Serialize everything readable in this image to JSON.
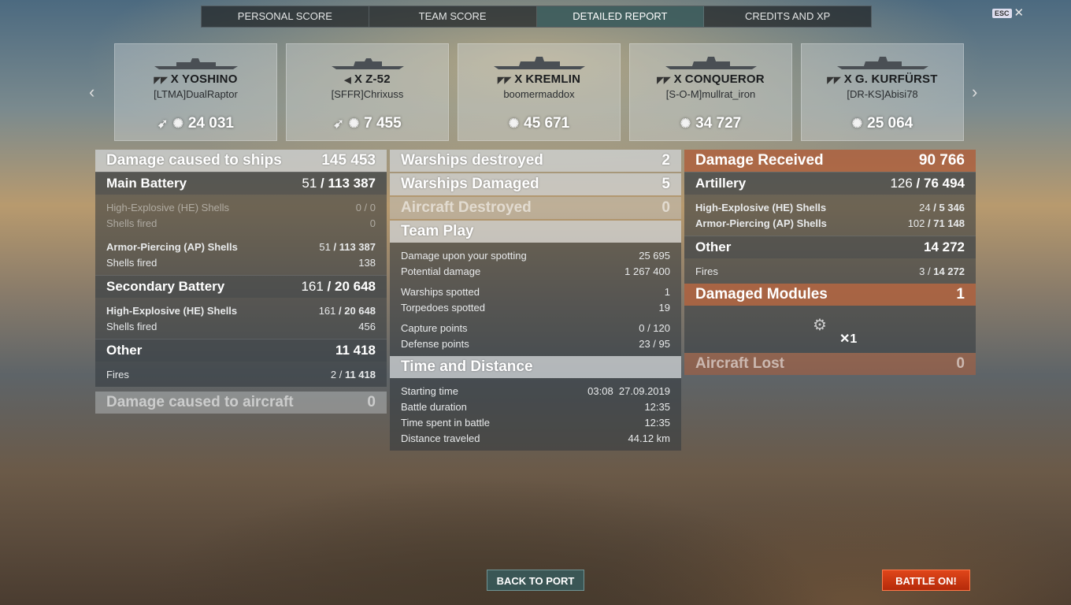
{
  "tabs": [
    "PERSONAL SCORE",
    "TEAM SCORE",
    "DETAILED REPORT",
    "CREDITS AND XP"
  ],
  "active_tab": "DETAILED REPORT",
  "esc": {
    "key": "ESC",
    "close": "✕"
  },
  "cards": [
    {
      "tier": "X",
      "name": "YOSHINO",
      "player": "[LTMA]DualRaptor",
      "score": "24 031",
      "icon": "torpedo-icon"
    },
    {
      "tier": "X",
      "name": "Z-52",
      "player": "[SFFR]Chrixuss",
      "score": "7 455",
      "icon": "torpedo-icon"
    },
    {
      "tier": "X",
      "name": "KREMLIN",
      "player": "boomermaddox",
      "score": "45 671"
    },
    {
      "tier": "X",
      "name": "CONQUEROR",
      "player": "[S-O-M]mullrat_iron",
      "score": "34 727"
    },
    {
      "tier": "X",
      "name": "G. KURFÜRST",
      "player": "[DR-KS]Abisi78",
      "score": "25 064"
    }
  ],
  "dmg": {
    "title": "Damage caused to ships",
    "total": "145 453",
    "main": {
      "title": "Main Battery",
      "a": "51",
      "b": "113 387"
    },
    "he_label": "High-Explosive (HE) Shells",
    "he_val": "0 / 0",
    "fired_label": "Shells fired",
    "he_fired": "0",
    "ap_label": "Armor-Piercing (AP) Shells",
    "ap_a": "51",
    "ap_b": "113 387",
    "ap_fired": "138",
    "sec": {
      "title": "Secondary Battery",
      "a": "161",
      "b": "20 648"
    },
    "sec_he_a": "161",
    "sec_he_b": "20 648",
    "sec_fired": "456",
    "other": {
      "title": "Other",
      "val": "11 418"
    },
    "fires_label": "Fires",
    "fires_a": "2",
    "fires_b": "11 418",
    "aircraft": {
      "title": "Damage caused to aircraft",
      "val": "0"
    }
  },
  "mid": {
    "destroyed": {
      "label": "Warships destroyed",
      "val": "2"
    },
    "damaged": {
      "label": "Warships Damaged",
      "val": "5"
    },
    "aircraft": {
      "label": "Aircraft Destroyed",
      "val": "0"
    },
    "team": {
      "title": "Team Play",
      "spot_dmg": [
        "Damage upon your spotting",
        "25 695"
      ],
      "potential": [
        "Potential damage",
        "1 267 400"
      ],
      "spotted": [
        "Warships spotted",
        "1"
      ],
      "torps": [
        "Torpedoes spotted",
        "19"
      ],
      "capture": [
        "Capture points",
        "0 / 120"
      ],
      "defense": [
        "Defense points",
        "23 / 95"
      ]
    },
    "time": {
      "title": "Time and Distance",
      "start": [
        "Starting time",
        "03:08  27.09.2019"
      ],
      "duration": [
        "Battle duration",
        "12:35"
      ],
      "spent": [
        "Time spent in battle",
        "12:35"
      ],
      "distance": [
        "Distance traveled",
        "44.12 km"
      ]
    }
  },
  "recv": {
    "title": "Damage Received",
    "total": "90 766",
    "art": {
      "title": "Artillery",
      "a": "126",
      "b": "76 494"
    },
    "he": {
      "label": "High-Explosive (HE) Shells",
      "a": "24",
      "b": "5 346"
    },
    "ap": {
      "label": "Armor-Piercing (AP) Shells",
      "a": "102",
      "b": "71 148"
    },
    "other": {
      "title": "Other",
      "val": "14 272"
    },
    "fires": {
      "label": "Fires",
      "a": "3",
      "b": "14 272"
    },
    "modules": {
      "title": "Damaged Modules",
      "val": "1",
      "count": "1"
    },
    "aircraft_lost": {
      "title": "Aircraft Lost",
      "val": "0"
    }
  },
  "buttons": {
    "back": "BACK TO PORT",
    "battle": "BATTLE ON!"
  }
}
